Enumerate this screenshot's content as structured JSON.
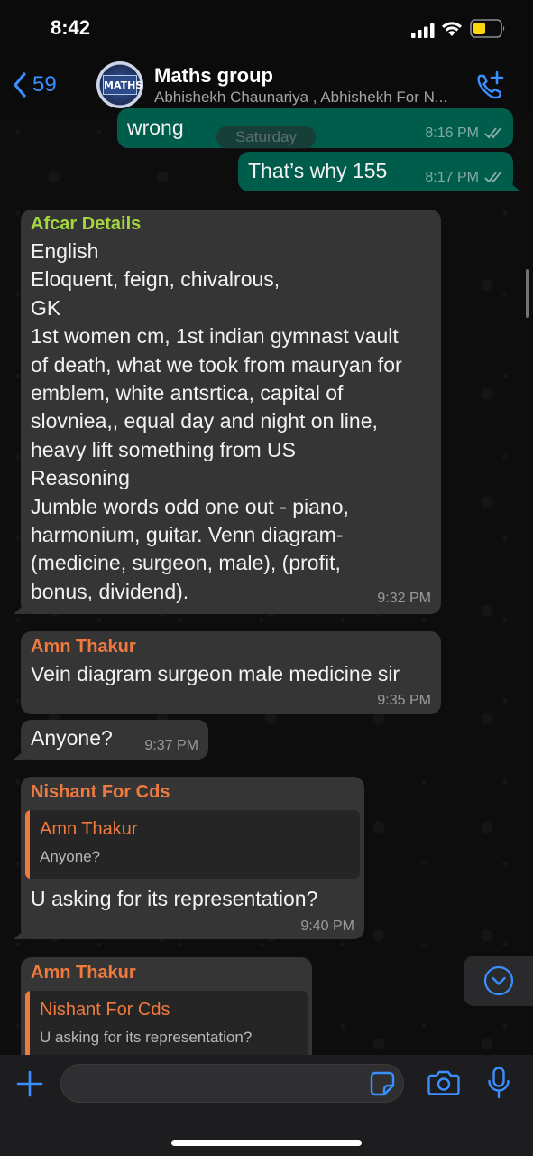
{
  "status_bar": {
    "time": "8:42"
  },
  "header": {
    "back_count": "59",
    "avatar_text": "MATHS",
    "title": "Maths group",
    "subtitle": "Abhishekh Chaunariya , Abhishekh For N..."
  },
  "date_divider": "Saturday",
  "messages": [
    {
      "direction": "outgoing",
      "text": "wrong",
      "time": "8:16 PM",
      "status": "read"
    },
    {
      "direction": "outgoing",
      "text": "That’s why 155",
      "time": "8:17 PM",
      "status": "read"
    },
    {
      "direction": "incoming",
      "sender": "Afcar Details",
      "sender_color": "#a6d63f",
      "text": "English\nEloquent, feign,  chivalrous,\nGK\n1st women cm,  1st indian gymnast vault\nof death,  what we took from mauryan for\nemblem,  white antsrtica,  capital of\nslovniea,, equal day and night on line,\nheavy lift something from US\nReasoning\nJumble words odd one out - piano,\nharmonium, guitar. Venn diagram-\n(medicine, surgeon, male), (profit,\nbonus, dividend).",
      "time": "9:32 PM"
    },
    {
      "direction": "incoming",
      "sender": "Amn Thakur",
      "sender_color": "#f07a3e",
      "text": "Vein  diagram surgeon male medicine sir",
      "time": "9:35 PM"
    },
    {
      "direction": "incoming",
      "text": "Anyone?",
      "time": "9:37 PM"
    },
    {
      "direction": "incoming",
      "sender": "Nishant For Cds",
      "sender_color": "#f07a3e",
      "quote": {
        "sender": "Amn Thakur",
        "text": "Anyone?"
      },
      "text": "U asking for its representation?",
      "time": "9:40 PM"
    },
    {
      "direction": "incoming",
      "sender": "Amn Thakur",
      "sender_color": "#f07a3e",
      "quote": {
        "sender": "Nishant For Cds",
        "text": "U asking for its representation?"
      }
    }
  ],
  "input": {
    "placeholder": ""
  },
  "colors": {
    "accent": "#3a8fff",
    "outgoing_bubble": "#005c4b",
    "incoming_bubble": "#353535"
  }
}
